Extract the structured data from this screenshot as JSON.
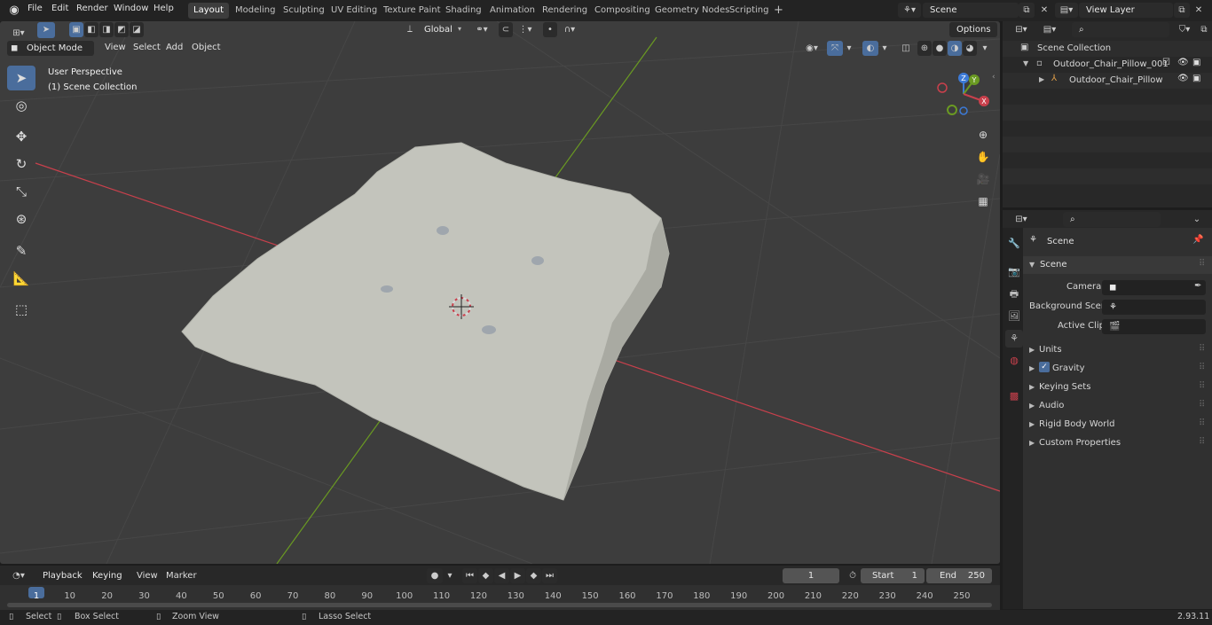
{
  "menu": {
    "file": "File",
    "edit": "Edit",
    "render": "Render",
    "window": "Window",
    "help": "Help"
  },
  "workspaces": [
    "Layout",
    "Modeling",
    "Sculpting",
    "UV Editing",
    "Texture Paint",
    "Shading",
    "Animation",
    "Rendering",
    "Compositing",
    "Geometry Nodes",
    "Scripting"
  ],
  "add_workspace": "+",
  "scene_field": "Scene",
  "view_layer_field": "View Layer",
  "header": {
    "transform_orientation": "Global",
    "options": "Options"
  },
  "viewport": {
    "mode": "Object Mode",
    "view": "View",
    "select": "Select",
    "add": "Add",
    "object": "Object",
    "overlay_title": "User Perspective",
    "overlay_subtitle": "(1) Scene Collection",
    "gizmo": {
      "x": "X",
      "y": "Y",
      "z": "Z"
    }
  },
  "outliner": {
    "scene_collection": "Scene Collection",
    "items": [
      {
        "label": "Outdoor_Chair_Pillow_001"
      },
      {
        "label": "Outdoor_Chair_Pillow"
      }
    ]
  },
  "properties": {
    "context": "Scene",
    "panel_scene": "Scene",
    "camera_label": "Camera",
    "background_scene_label": "Background Scene",
    "active_clip_label": "Active Clip",
    "panels": [
      "Units",
      "Gravity",
      "Keying Sets",
      "Audio",
      "Rigid Body World",
      "Custom Properties"
    ],
    "gravity_checked": true
  },
  "timeline": {
    "playback": "Playback",
    "keying": "Keying",
    "view": "View",
    "marker": "Marker",
    "current_frame": "1",
    "start_label": "Start",
    "start": "1",
    "end_label": "End",
    "end": "250",
    "ticks": [
      "1",
      "10",
      "20",
      "30",
      "40",
      "50",
      "60",
      "70",
      "80",
      "90",
      "100",
      "110",
      "120",
      "130",
      "140",
      "150",
      "160",
      "170",
      "180",
      "190",
      "200",
      "210",
      "220",
      "230",
      "240",
      "250"
    ]
  },
  "statusbar": {
    "select": "Select",
    "box_select": "Box Select",
    "zoom_view": "Zoom View",
    "lasso_select": "Lasso Select",
    "version": "2.93.11"
  },
  "colors": {
    "accent": "#4a6d9c",
    "x_axis": "#c9404c",
    "y_axis": "#6a9a22",
    "mesh": "#c3c4bc",
    "viewport_bg": "#3d3d3d"
  }
}
